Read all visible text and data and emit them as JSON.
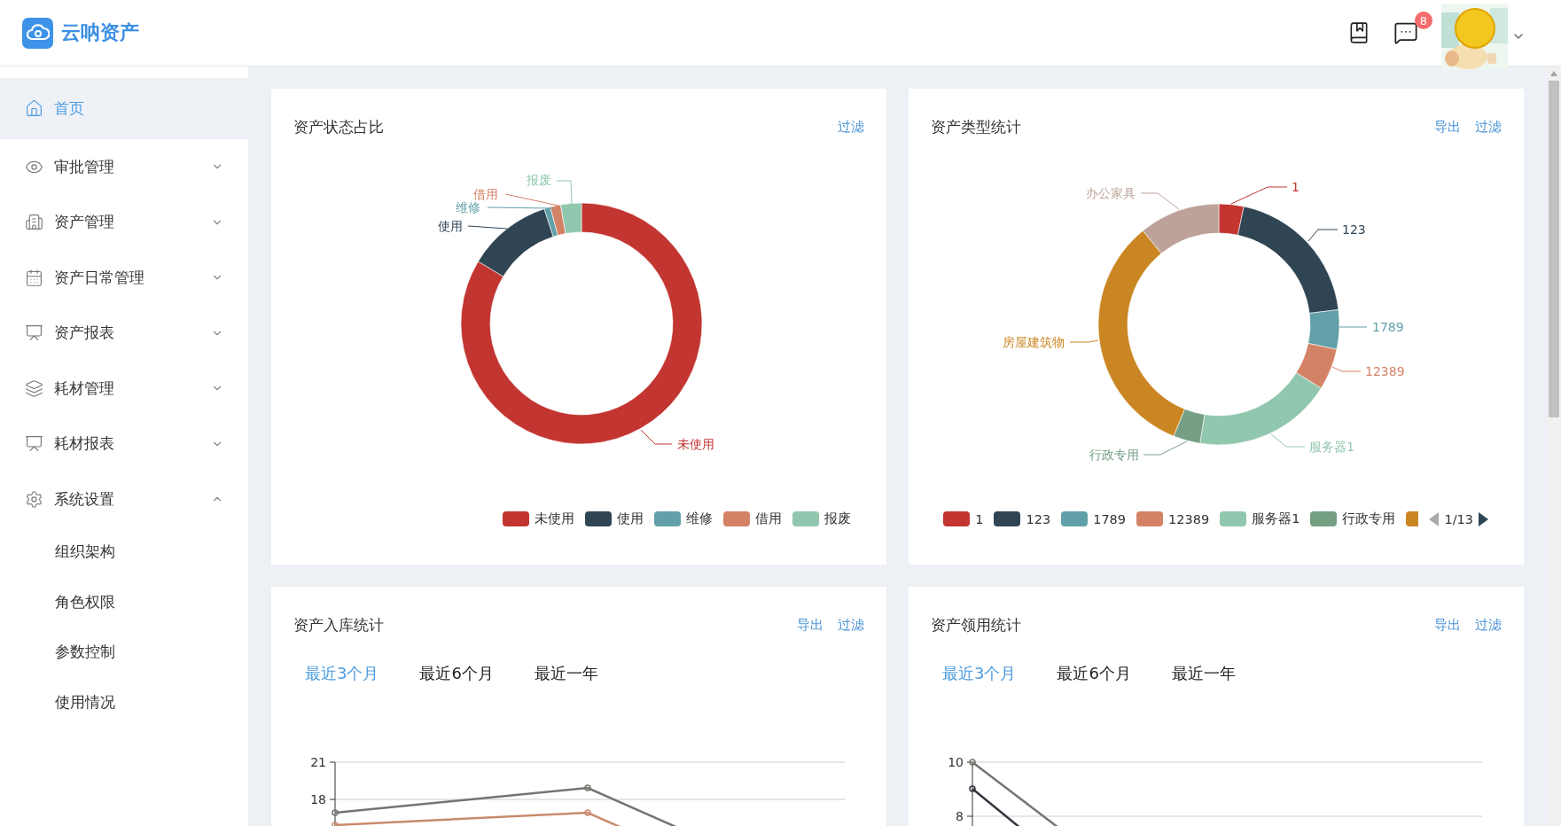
{
  "header": {
    "logo_text": "云呐资产",
    "message_badge": "8"
  },
  "sidebar": {
    "items": [
      {
        "label": "首页",
        "kind": "link",
        "selected": true
      },
      {
        "label": "审批管理",
        "kind": "group",
        "selected": false,
        "expanded": false
      },
      {
        "label": "资产管理",
        "kind": "group",
        "selected": false,
        "expanded": false
      },
      {
        "label": "资产日常管理",
        "kind": "group",
        "selected": false,
        "expanded": false
      },
      {
        "label": "资产报表",
        "kind": "group",
        "selected": false,
        "expanded": false
      },
      {
        "label": "耗材管理",
        "kind": "group",
        "selected": false,
        "expanded": false
      },
      {
        "label": "耗材报表",
        "kind": "group",
        "selected": false,
        "expanded": false
      },
      {
        "label": "系统设置",
        "kind": "group",
        "selected": false,
        "expanded": true,
        "children": [
          {
            "label": "组织架构",
            "selected": false
          },
          {
            "label": "角色权限",
            "selected": false
          },
          {
            "label": "参数控制",
            "selected": false
          },
          {
            "label": "使用情况",
            "selected": false
          }
        ]
      }
    ]
  },
  "cards": [
    {
      "kind": "donut",
      "title": "资产状态占比",
      "actions": [
        "过滤"
      ],
      "slices": [
        {
          "label": "未使用",
          "color": "#c23531"
        },
        {
          "label": "使用",
          "color": "#2f4554"
        },
        {
          "label": "维修",
          "color": "#61a0a8"
        },
        {
          "label": "借用",
          "color": "#d48265"
        },
        {
          "label": "报废",
          "color": "#91c7ae"
        }
      ],
      "legend": [
        {
          "label": "未使用",
          "color": "#c23531"
        },
        {
          "label": "使用",
          "color": "#2f4554"
        },
        {
          "label": "维修",
          "color": "#61a0a8"
        },
        {
          "label": "借用",
          "color": "#d48265"
        },
        {
          "label": "报废",
          "color": "#91c7ae"
        }
      ]
    },
    {
      "kind": "donut",
      "title": "资产类型统计",
      "actions": [
        "导出",
        "过滤"
      ],
      "slices": [
        {
          "label": "1",
          "color": "#c23531"
        },
        {
          "label": "123",
          "color": "#2f4554"
        },
        {
          "label": "1789",
          "color": "#61a0a8"
        },
        {
          "label": "12389",
          "color": "#d48265"
        },
        {
          "label": "服务器1",
          "color": "#91c7ae"
        },
        {
          "label": "行政专用",
          "color": "#749f83"
        },
        {
          "label": "房屋建筑物",
          "color": "#ca8622"
        },
        {
          "label": "办公家具",
          "color": "#bda29a"
        }
      ],
      "legend": [
        {
          "label": "1",
          "color": "#c23531"
        },
        {
          "label": "123",
          "color": "#2f4554"
        },
        {
          "label": "1789",
          "color": "#61a0a8"
        },
        {
          "label": "12389",
          "color": "#d48265"
        },
        {
          "label": "服务器1",
          "color": "#91c7ae"
        },
        {
          "label": "行政专用",
          "color": "#749f83"
        },
        {
          "color": "#ca8622",
          "cut": true
        }
      ],
      "pager": {
        "text": "1/13",
        "prev_disabled": true,
        "next_disabled": false
      }
    },
    {
      "kind": "line",
      "title": "资产入库统计",
      "actions": [
        "导出",
        "过滤"
      ],
      "tabs": [
        {
          "label": "最近3个月",
          "selected": true
        },
        {
          "label": "最近6个月",
          "selected": false
        },
        {
          "label": "最近一年",
          "selected": false
        }
      ],
      "y_ticks": [
        "21",
        "18"
      ]
    },
    {
      "kind": "line",
      "title": "资产领用统计",
      "actions": [
        "导出",
        "过滤"
      ],
      "tabs": [
        {
          "label": "最近3个月",
          "selected": true
        },
        {
          "label": "最近6个月",
          "selected": false
        },
        {
          "label": "最近一年",
          "selected": false
        }
      ],
      "y_ticks": [
        "10",
        "8"
      ]
    }
  ]
}
